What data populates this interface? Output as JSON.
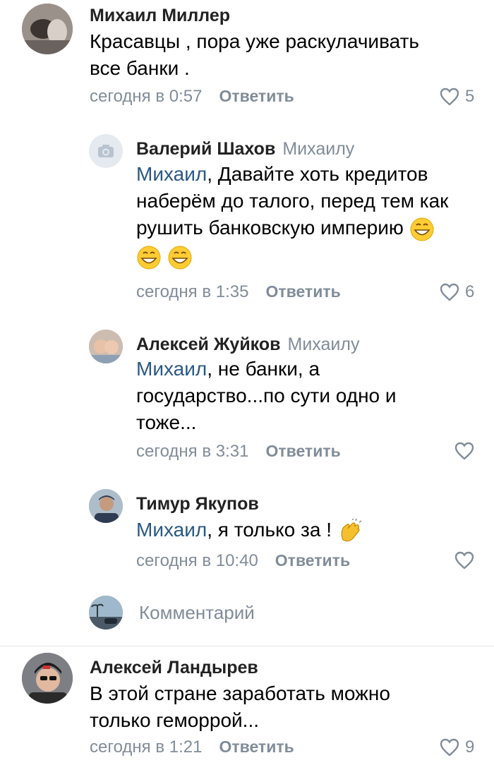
{
  "comments": [
    {
      "author": "Михаил Миллер",
      "lines": [
        "Красавцы , пора уже раскулачивать",
        "все банки ."
      ],
      "time": "сегодня в 0:57",
      "reply_label": "Ответить",
      "likes": "5"
    },
    {
      "author": "Валерий Шахов",
      "addressee": "Михаилу",
      "mention": "Михаил",
      "lines": [
        ", Давайте хоть кредитов",
        "наберём до талого, перед тем как",
        "рушить банковскую империю"
      ],
      "time": "сегодня в 1:35",
      "reply_label": "Ответить",
      "likes": "6"
    },
    {
      "author": "Алексей Жуйков",
      "addressee": "Михаилу",
      "mention": "Михаил",
      "lines": [
        ", не банки, а",
        "государство...по сути одно и",
        "тоже..."
      ],
      "time": "сегодня в 3:31",
      "reply_label": "Ответить"
    },
    {
      "author": "Тимур Якупов",
      "mention": "Михаил",
      "lines": [
        ", я только за !"
      ],
      "time": "сегодня в 10:40",
      "reply_label": "Ответить"
    },
    {
      "author": "Алексей Ландырев",
      "lines": [
        "В этой стране заработать можно",
        "только геморрой..."
      ],
      "time": "сегодня в 1:21",
      "reply_label": "Ответить",
      "likes": "9"
    }
  ],
  "compose": {
    "placeholder": "Комментарий"
  },
  "colors": {
    "link": "#2a5885",
    "meta": "#818c99",
    "divider": "#e7e8ec"
  },
  "icons": [
    "heart-icon",
    "camera-icon",
    "grinning-emoji-icon",
    "clapping-hands-icon"
  ]
}
